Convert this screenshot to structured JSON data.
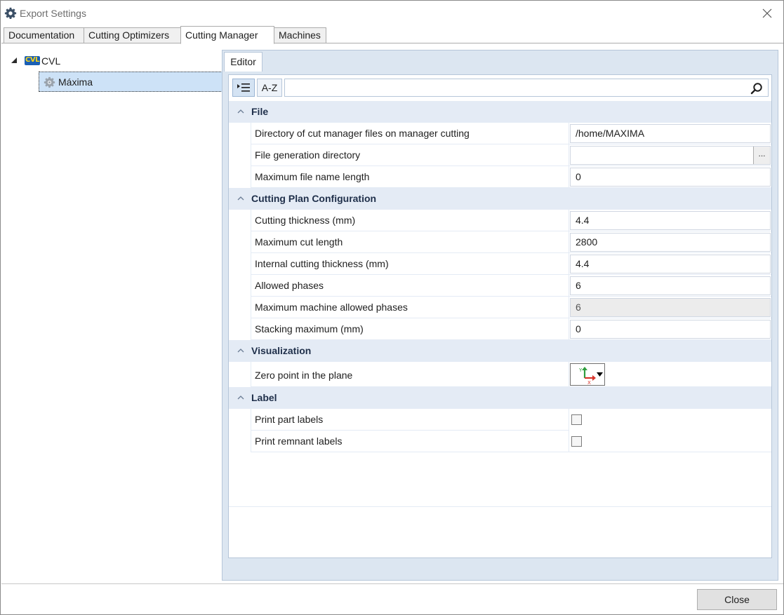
{
  "window": {
    "title": "Export Settings",
    "icon": "gear-icon",
    "close_icon": "close-icon"
  },
  "tabs": [
    {
      "label": "Documentation",
      "active": false
    },
    {
      "label": "Cutting Optimizers",
      "active": false
    },
    {
      "label": "Cutting Manager",
      "active": true
    },
    {
      "label": "Machines",
      "active": false
    }
  ],
  "tree": {
    "root": {
      "label": "CVL",
      "icon_text": "CVL",
      "expanded": true
    },
    "child": {
      "label": "Máxima",
      "selected": true
    }
  },
  "editor": {
    "tab_label": "Editor",
    "toolbar": {
      "categorized_icon": "categorized-list-icon",
      "az_label": "A-Z",
      "search_value": "",
      "search_placeholder": ""
    },
    "categories": [
      {
        "label": "File",
        "rows": [
          {
            "name": "Directory of cut manager files on manager cutting",
            "value": "/home/MAXIMA",
            "kind": "text"
          },
          {
            "name": "File generation directory",
            "value": "",
            "kind": "browse",
            "browse_label": "..."
          },
          {
            "name": "Maximum file name length",
            "value": "0",
            "kind": "text"
          }
        ]
      },
      {
        "label": "Cutting Plan Configuration",
        "rows": [
          {
            "name": "Cutting thickness (mm)",
            "value": "4.4",
            "kind": "text"
          },
          {
            "name": "Maximum cut length",
            "value": "2800",
            "kind": "text"
          },
          {
            "name": "Internal cutting thickness (mm)",
            "value": "4.4",
            "kind": "text"
          },
          {
            "name": "Allowed phases",
            "value": "6",
            "kind": "text"
          },
          {
            "name": "Maximum machine allowed phases",
            "value": "6",
            "kind": "disabled"
          },
          {
            "name": "Stacking maximum (mm)",
            "value": "0",
            "kind": "text"
          }
        ]
      },
      {
        "label": "Visualization",
        "rows": [
          {
            "name": "Zero point in the plane",
            "value": "",
            "kind": "axis-picker",
            "axis_y": "Y",
            "axis_x": "X"
          }
        ]
      },
      {
        "label": "Label",
        "rows": [
          {
            "name": "Print part labels",
            "value": false,
            "kind": "checkbox"
          },
          {
            "name": "Print remnant labels",
            "value": false,
            "kind": "checkbox"
          }
        ]
      }
    ]
  },
  "footer": {
    "close_label": "Close"
  },
  "colors": {
    "category_bg": "#e4ebf5",
    "selection_bg": "#cde2f7",
    "panel_bg": "#dce6f1",
    "axis_y": "#2e9e3f",
    "axis_x": "#d9342b"
  }
}
